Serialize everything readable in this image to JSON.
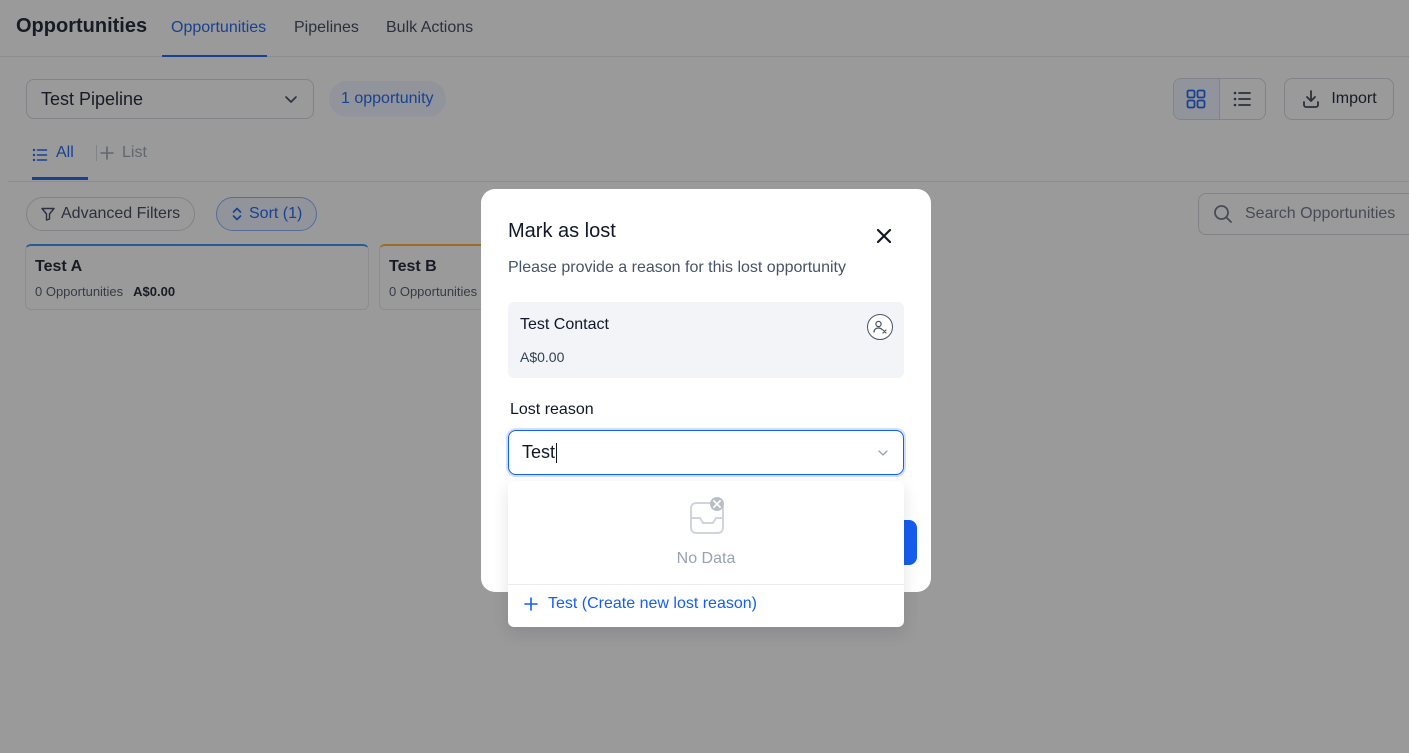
{
  "header": {
    "title": "Opportunities",
    "tabs": [
      {
        "label": "Opportunities",
        "active": true
      },
      {
        "label": "Pipelines",
        "active": false
      },
      {
        "label": "Bulk Actions",
        "active": false
      }
    ]
  },
  "toolbar": {
    "pipeline_value": "Test Pipeline",
    "count_badge": "1 opportunity",
    "view_mode": "grid",
    "import_label": "Import"
  },
  "list_tabs": {
    "all_label": "All",
    "add_label": "List"
  },
  "filters": {
    "advanced_label": "Advanced Filters",
    "sort_label": "Sort (1)",
    "search_placeholder": "Search Opportunities"
  },
  "stages": [
    {
      "name": "Test A",
      "count": "0 Opportunities",
      "amount": "A$0.00",
      "accent": "#2e90fa"
    },
    {
      "name": "Test B",
      "count": "0 Opportunities",
      "amount": "",
      "accent": "#fdb022"
    }
  ],
  "modal": {
    "title": "Mark as lost",
    "subtitle": "Please provide a reason for this lost opportunity",
    "contact_name": "Test Contact",
    "contact_amount": "A$0.00",
    "lost_reason_label": "Lost reason",
    "lost_reason_value": "Test"
  },
  "dropdown": {
    "empty_text": "No Data",
    "create_option": "Test (Create new lost reason)"
  },
  "colors": {
    "accent": "#155eef",
    "overlay": "rgba(30,30,30,0.45)"
  },
  "icons": [
    "chevron-down-icon",
    "grid-view-icon",
    "list-view-icon",
    "download-icon",
    "list-icon",
    "plus-icon",
    "filter-icon",
    "sort-icon",
    "search-icon",
    "close-icon",
    "contact-remove-icon",
    "empty-inbox-icon"
  ]
}
